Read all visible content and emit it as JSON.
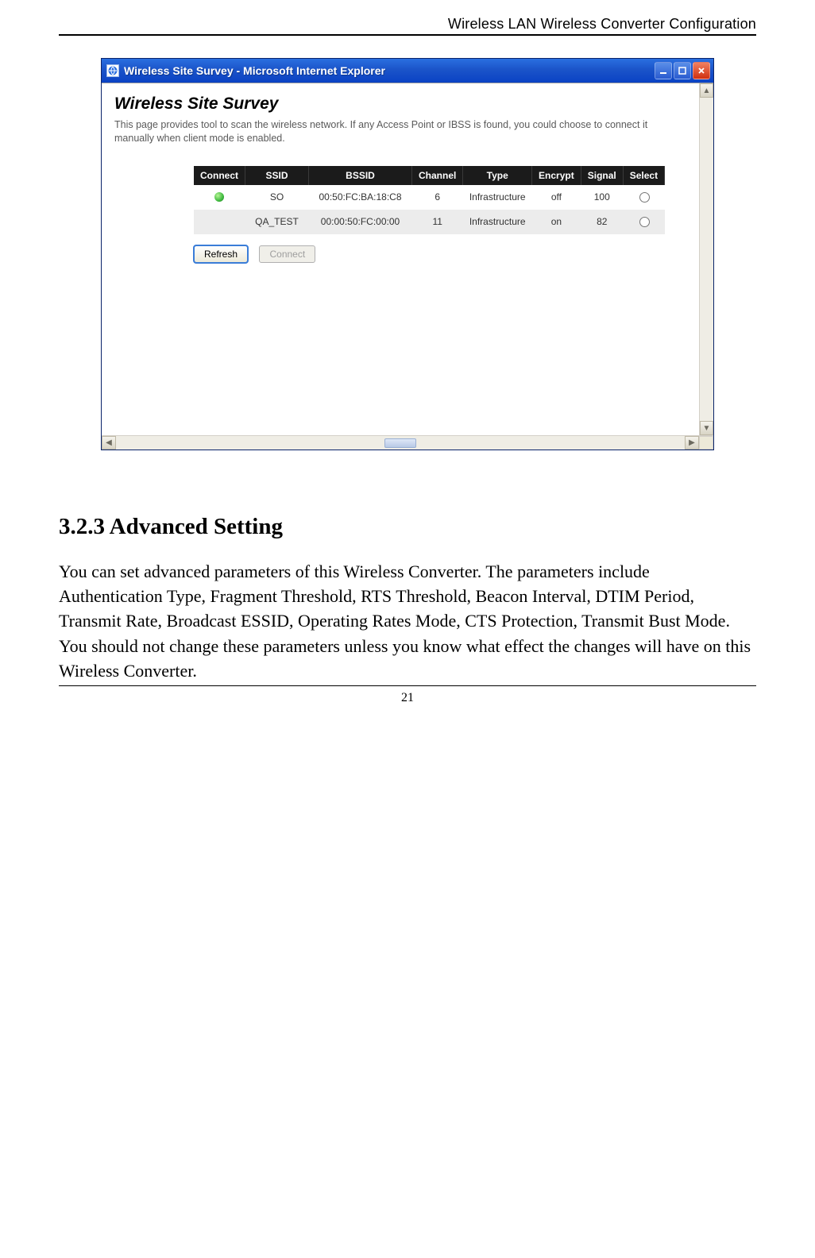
{
  "doc": {
    "running_header": "Wireless LAN Wireless Converter Configuration",
    "page_number": "21",
    "section_heading": "3.2.3   Advanced Setting",
    "body_para": "You can set advanced parameters of this Wireless Converter. The parameters include Authentication Type, Fragment Threshold, RTS Threshold, Beacon Interval, DTIM Period, Transmit Rate, Broadcast ESSID, Operating Rates Mode, CTS Protection, Transmit Bust Mode. You should not change these parameters unless you know what effect the changes will have on this Wireless Converter."
  },
  "window": {
    "title": "Wireless Site Survey - Microsoft Internet Explorer",
    "page_title": "Wireless Site Survey",
    "page_desc": "This page provides tool to scan the wireless network. If any Access Point or IBSS is found, you could choose to connect it manually when client mode is enabled.",
    "columns": {
      "c0": "Connect",
      "c1": "SSID",
      "c2": "BSSID",
      "c3": "Channel",
      "c4": "Type",
      "c5": "Encrypt",
      "c6": "Signal",
      "c7": "Select"
    },
    "rows": [
      {
        "connected": true,
        "ssid": "SO",
        "bssid": "00:50:FC:BA:18:C8",
        "channel": "6",
        "type": "Infrastructure",
        "encrypt": "off",
        "signal": "100"
      },
      {
        "connected": false,
        "ssid": "QA_TEST",
        "bssid": "00:00:50:FC:00:00",
        "channel": "11",
        "type": "Infrastructure",
        "encrypt": "on",
        "signal": "82"
      }
    ],
    "buttons": {
      "refresh": "Refresh",
      "connect": "Connect"
    }
  }
}
